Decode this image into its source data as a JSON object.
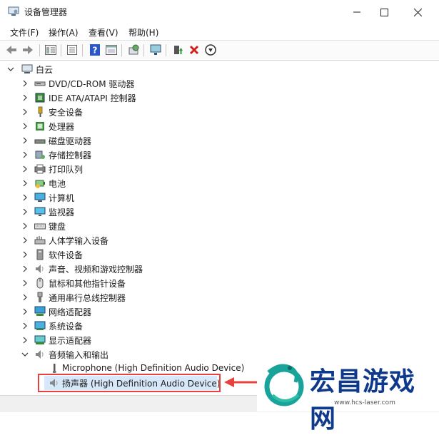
{
  "window": {
    "title": "设备管理器"
  },
  "menu": [
    "文件(F)",
    "操作(A)",
    "查看(V)",
    "帮助(H)"
  ],
  "toolbar": {
    "buttons": [
      "back-arrow-icon",
      "forward-arrow-icon",
      "properties-panel-icon",
      "device-list-icon",
      "help-icon",
      "console-icon",
      "scan-hardware-icon",
      "monitor-icon",
      "update-driver-icon",
      "uninstall-x-icon",
      "download-circle-icon"
    ]
  },
  "tree": {
    "root": "白云",
    "categories": [
      {
        "label": "DVD/CD-ROM 驱动器",
        "icon": "dvd-drive-icon"
      },
      {
        "label": "IDE ATA/ATAPI 控制器",
        "icon": "ide-controller-icon"
      },
      {
        "label": "安全设备",
        "icon": "security-key-icon"
      },
      {
        "label": "处理器",
        "icon": "processor-icon"
      },
      {
        "label": "磁盘驱动器",
        "icon": "disk-drive-icon"
      },
      {
        "label": "存储控制器",
        "icon": "storage-controller-icon"
      },
      {
        "label": "打印队列",
        "icon": "printer-icon"
      },
      {
        "label": "电池",
        "icon": "battery-icon"
      },
      {
        "label": "计算机",
        "icon": "computer-icon"
      },
      {
        "label": "监视器",
        "icon": "monitor-icon"
      },
      {
        "label": "键盘",
        "icon": "keyboard-icon"
      },
      {
        "label": "人体学输入设备",
        "icon": "hid-icon"
      },
      {
        "label": "软件设备",
        "icon": "software-device-icon"
      },
      {
        "label": "声音、视频和游戏控制器",
        "icon": "speaker-icon"
      },
      {
        "label": "鼠标和其他指针设备",
        "icon": "mouse-icon"
      },
      {
        "label": "通用串行总线控制器",
        "icon": "usb-icon"
      },
      {
        "label": "网络适配器",
        "icon": "network-adapter-icon"
      },
      {
        "label": "系统设备",
        "icon": "system-device-icon"
      },
      {
        "label": "显示适配器",
        "icon": "display-adapter-icon"
      },
      {
        "label": "音频输入和输出",
        "icon": "audio-io-icon",
        "expanded": true
      }
    ],
    "audio_children": [
      {
        "label": "Microphone (High Definition Audio Device)",
        "icon": "microphone-icon"
      },
      {
        "label": "扬声器 (High Definition Audio Device)",
        "icon": "speaker-icon",
        "selected": true
      }
    ]
  },
  "annotation": {
    "highlight_color": "#e8413d"
  },
  "watermark": {
    "text": "宏昌游戏网",
    "url": "www.hcs-laser.com"
  },
  "colors": {
    "selection": "#d6e8fa",
    "watermark_blue": "#0f3a8c",
    "logo_teal": "#1aa39a"
  }
}
